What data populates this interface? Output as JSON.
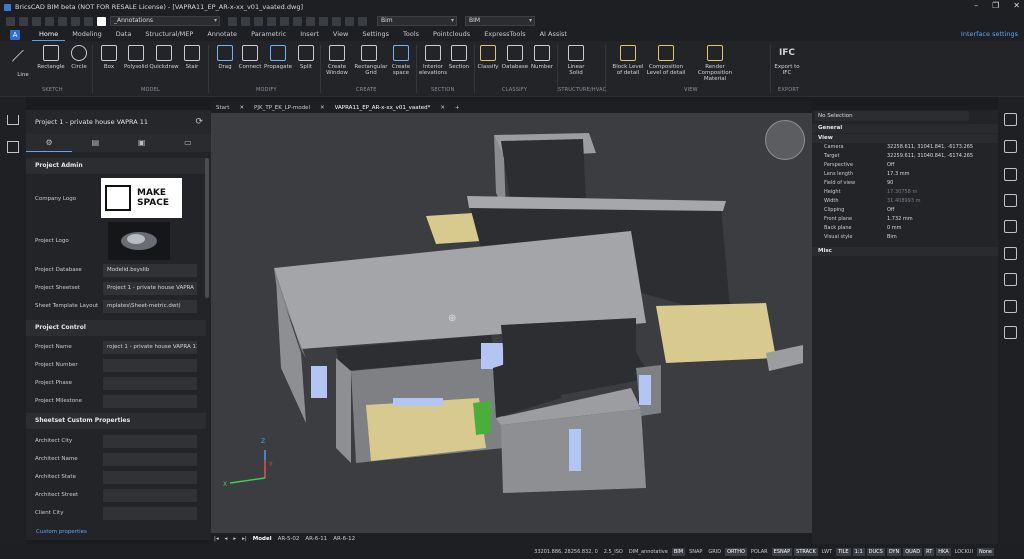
{
  "window": {
    "title": "BricsCAD BIM beta (NOT FOR RESALE License) - [VAPRA11_EP_AR-x-xx_v01_vaated.dwg]"
  },
  "quick_access": {
    "layer_combo": "_Annotations",
    "workspace_combo": "Bim",
    "extra_combo": "BIM"
  },
  "menu": {
    "logo": "A",
    "tabs": [
      "Home",
      "Modeling",
      "Data",
      "Structural/MEP",
      "Annotate",
      "Parametric",
      "Insert",
      "View",
      "Settings",
      "Tools",
      "Pointclouds",
      "ExpressTools",
      "AI Assist"
    ],
    "right_link": "Interface settings"
  },
  "ribbon": {
    "buttons": [
      "Line",
      "Rectangle",
      "Circle",
      "Box",
      "Polysolid",
      "Quickdraw",
      "Stair",
      "Drag",
      "Connect",
      "Propagate",
      "Split",
      "Create Window",
      "Rectangular Grid",
      "Create space",
      "Interior elevations",
      "Section",
      "Classify",
      "Database",
      "Number",
      "Linear Solid",
      "Block Level of detail",
      "Composition Level of detail",
      "Render Composition Material",
      "Export to IFC"
    ],
    "groups": [
      "SKETCH",
      "MODEL",
      "MODIFY",
      "CREATE",
      "SECTION",
      "CLASSIFY",
      "STRUCTURE/HVAC",
      "VIEW",
      "EXPORT"
    ],
    "ifc_label": "IFC"
  },
  "left_panel": {
    "title": "Project 1 - private house VAPRA 11",
    "sections": {
      "admin": "Project Admin",
      "control": "Project Control",
      "custom": "Sheetset Custom Properties"
    },
    "admin_rows": [
      {
        "label": "Company Logo"
      },
      {
        "label": "Project Logo"
      },
      {
        "label": "Project Database",
        "value": "Modelid.bsyslib"
      },
      {
        "label": "Project Sheetset",
        "value": "Project 1 - private house VAPRA"
      },
      {
        "label": "Sheet Template Layout",
        "value": "mplates\\Sheet-metric.dwt)"
      }
    ],
    "company_logo_text": [
      "MAKE",
      "SPACE"
    ],
    "control_rows": [
      {
        "label": "Project Name",
        "value": "roject 1 - private house VAPRA 11"
      },
      {
        "label": "Project Number",
        "value": ""
      },
      {
        "label": "Project Phase",
        "value": ""
      },
      {
        "label": "Project Milestone",
        "value": ""
      }
    ],
    "custom_rows": [
      {
        "label": "Architect City",
        "value": ""
      },
      {
        "label": "Architect Name",
        "value": ""
      },
      {
        "label": "Architect State",
        "value": ""
      },
      {
        "label": "Architect Street",
        "value": ""
      },
      {
        "label": "Client City",
        "value": ""
      }
    ],
    "custom_properties_link": "Custom properties"
  },
  "doc_tabs": [
    "Start",
    "PJK_TP_EK_LP-model",
    "VAPRA11_EP_AR-x-xx_v01_vaated*"
  ],
  "layout_tabs": [
    "Model",
    "AR-5-02",
    "AR-6-11",
    "AR-6-12"
  ],
  "axes": {
    "x": "X",
    "y": "Y",
    "z": "Z"
  },
  "status": {
    "coords": "33201.886, 28256.832, 0",
    "toggles": [
      "2.5_ISO",
      "DIM_annotative",
      "BIM",
      "SNAP",
      "GRID",
      "ORTHO",
      "POLAR",
      "ESNAP",
      "STRACK",
      "LWT",
      "TILE",
      "1:1",
      "DUCS",
      "DYN",
      "QUAD",
      "RT",
      "HKA",
      "LOCKUI",
      "None"
    ]
  },
  "properties": {
    "selection": "No Selection",
    "general_label": "General",
    "view_label": "View",
    "misc_label": "Misc",
    "rows": [
      {
        "k": "Camera",
        "v": "32258.611, 31041.841, -6173.265"
      },
      {
        "k": "Target",
        "v": "32259.611, 31040.841, -6174.265"
      },
      {
        "k": "Perspective",
        "v": "Off"
      },
      {
        "k": "Lens length",
        "v": "17.3 mm"
      },
      {
        "k": "Field of view",
        "v": "90"
      },
      {
        "k": "Height",
        "v": "17.30758 m"
      },
      {
        "k": "Width",
        "v": "31.408993 m"
      },
      {
        "k": "Clipping",
        "v": "Off"
      },
      {
        "k": "Front plane",
        "v": "1.732 mm"
      },
      {
        "k": "Back plane",
        "v": "0 mm"
      },
      {
        "k": "Visual style",
        "v": "Bim"
      }
    ]
  },
  "colors": {
    "accent": "#4aa3ff",
    "background": "#1b1c1f",
    "viewport": "#3b3d40"
  }
}
